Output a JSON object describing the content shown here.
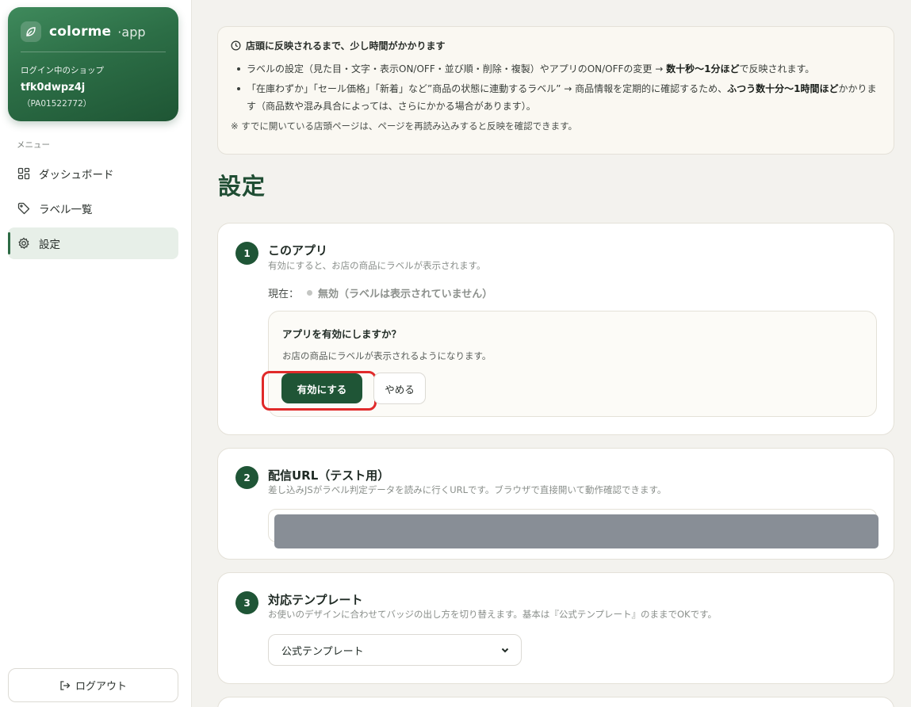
{
  "brand": {
    "name": "colorme",
    "suffix": "·app",
    "shop_label": "ログイン中のショップ",
    "shop_id": "tfk0dwpz4j",
    "shop_code": "（PA01522772）"
  },
  "sidebar": {
    "menu_label": "メニュー",
    "items": [
      {
        "label": "ダッシュボード",
        "icon": "dashboard-icon",
        "active": false
      },
      {
        "label": "ラベル一覧",
        "icon": "tag-icon",
        "active": false
      },
      {
        "label": "設定",
        "icon": "gear-icon",
        "active": true
      }
    ],
    "logout_label": "ログアウト"
  },
  "notice": {
    "title": "店頭に反映されるまで、少し時間がかかります",
    "item1_pre": "ラベルの設定（見た目・文字・表示ON/OFF・並び順・削除・複製）やアプリのON/OFFの変更 → ",
    "item1_bold": "数十秒〜1分ほど",
    "item1_post": "で反映されます。",
    "item2_pre": "「在庫わずか」「セール価格」「新着」など”商品の状態に連動するラベル” → 商品情報を定期的に確認するため、",
    "item2_bold": "ふつう数十分〜1時間ほど",
    "item2_post": "かかります（商品数や混み具合によっては、さらにかかる場合があります）。",
    "footnote": "※ すでに開いている店頭ページは、ページを再読み込みすると反映を確認できます。"
  },
  "page": {
    "title": "設定"
  },
  "sections": {
    "app": {
      "step": "1",
      "title": "このアプリ",
      "subtitle": "有効にすると、お店の商品にラベルが表示されます。",
      "status_label": "現在：",
      "status_value": "無効（ラベルは表示されていません）",
      "confirm_title": "アプリを有効にしますか？",
      "confirm_desc": "お店の商品にラベルが表示されるようになります。",
      "enable_label": "有効にする",
      "cancel_label": "やめる"
    },
    "url": {
      "step": "2",
      "title": "配信URL（テスト用）",
      "subtitle": "差し込みJSがラベル判定データを読みに行くURLです。ブラウザで直接開いて動作確認できます。"
    },
    "template": {
      "step": "3",
      "title": "対応テンプレート",
      "subtitle": "お使いのデザインに合わせてバッジの出し方を切り替えます。基本は『公式テンプレート』のままでOKです。",
      "selected": "公式テンプレート"
    }
  },
  "colors": {
    "brand_green": "#1f5536",
    "highlight_red": "#e02a2a",
    "page_bg": "#f3f2ee"
  }
}
